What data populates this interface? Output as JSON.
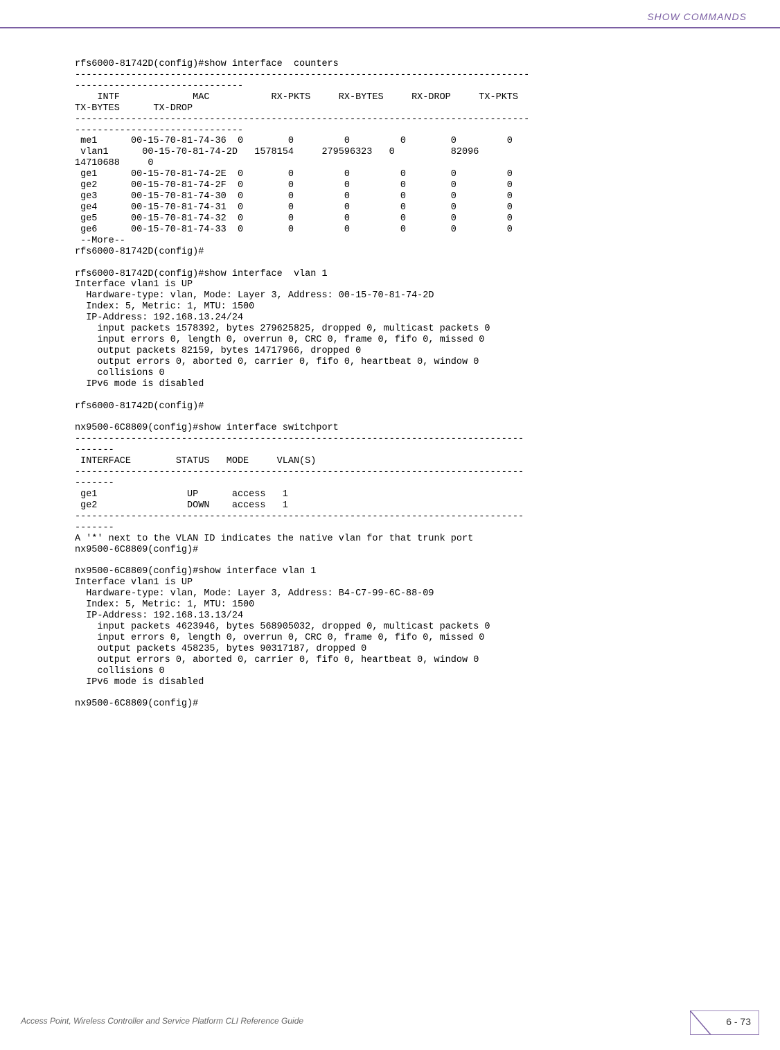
{
  "header": {
    "title": "SHOW COMMANDS"
  },
  "terminal": {
    "block1": "rfs6000-81742D(config)#show interface  counters\n---------------------------------------------------------------------------------\n------------------------------\n    INTF             MAC           RX-PKTS     RX-BYTES     RX-DROP     TX-PKTS     \nTX-BYTES      TX-DROP\n---------------------------------------------------------------------------------\n------------------------------\n me1      00-15-70-81-74-36  0        0         0         0        0         0\n vlan1      00-15-70-81-74-2D   1578154     279596323   0          82096     \n14710688     0\n ge1      00-15-70-81-74-2E  0        0         0         0        0         0\n ge2      00-15-70-81-74-2F  0        0         0         0        0         0\n ge3      00-15-70-81-74-30  0        0         0         0        0         0\n ge4      00-15-70-81-74-31  0        0         0         0        0         0\n ge5      00-15-70-81-74-32  0        0         0         0        0         0\n ge6      00-15-70-81-74-33  0        0         0         0        0         0\n --More--\nrfs6000-81742D(config)#\n\nrfs6000-81742D(config)#show interface  vlan 1\nInterface vlan1 is UP\n  Hardware-type: vlan, Mode: Layer 3, Address: 00-15-70-81-74-2D\n  Index: 5, Metric: 1, MTU: 1500\n  IP-Address: 192.168.13.24/24\n    input packets 1578392, bytes 279625825, dropped 0, multicast packets 0\n    input errors 0, length 0, overrun 0, CRC 0, frame 0, fifo 0, missed 0\n    output packets 82159, bytes 14717966, dropped 0\n    output errors 0, aborted 0, carrier 0, fifo 0, heartbeat 0, window 0\n    collisions 0\n  IPv6 mode is disabled\n\nrfs6000-81742D(config)#\n\nnx9500-6C8809(config)#show interface switchport\n--------------------------------------------------------------------------------\n-------\n INTERFACE        STATUS   MODE     VLAN(S)\n--------------------------------------------------------------------------------\n-------\n ge1                UP      access   1\n ge2                DOWN    access   1\n--------------------------------------------------------------------------------\n-------\nA '*' next to the VLAN ID indicates the native vlan for that trunk port\nnx9500-6C8809(config)#\n\nnx9500-6C8809(config)#show interface vlan 1\nInterface vlan1 is UP\n  Hardware-type: vlan, Mode: Layer 3, Address: B4-C7-99-6C-88-09\n  Index: 5, Metric: 1, MTU: 1500\n  IP-Address: 192.168.13.13/24\n    input packets 4623946, bytes 568905032, dropped 0, multicast packets 0\n    input errors 0, length 0, overrun 0, CRC 0, frame 0, fifo 0, missed 0\n    output packets 458235, bytes 90317187, dropped 0\n    output errors 0, aborted 0, carrier 0, fifo 0, heartbeat 0, window 0\n    collisions 0\n  IPv6 mode is disabled\n\nnx9500-6C8809(config)#"
  },
  "footer": {
    "text": "Access Point, Wireless Controller and Service Platform CLI Reference Guide",
    "page": "6 - 73"
  }
}
